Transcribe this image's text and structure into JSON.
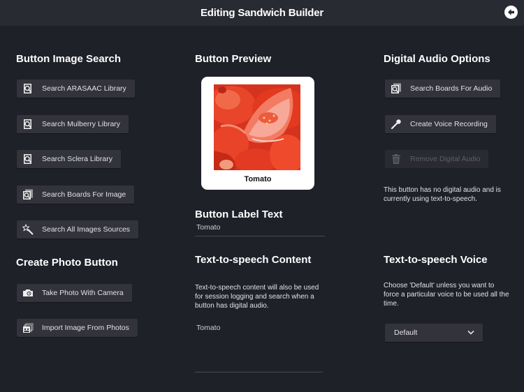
{
  "header": {
    "title": "Editing Sandwich Builder",
    "back_icon": "back-arrow-circle-icon"
  },
  "image_search": {
    "title": "Button Image Search",
    "buttons": [
      {
        "label": "Search ARASAAC Library",
        "icon": "library-search-icon"
      },
      {
        "label": "Search Mulberry Library",
        "icon": "library-search-icon"
      },
      {
        "label": "Search Sclera Library",
        "icon": "library-search-icon"
      },
      {
        "label": "Search Boards For Image",
        "icon": "boards-search-icon"
      },
      {
        "label": "Search All Images Sources",
        "icon": "magic-wand-icon"
      }
    ]
  },
  "photo": {
    "title": "Create Photo Button",
    "buttons": [
      {
        "label": "Take Photo With Camera",
        "icon": "camera-icon"
      },
      {
        "label": "Import Image From Photos",
        "icon": "photos-icon"
      }
    ]
  },
  "preview": {
    "title": "Button Preview",
    "label": "Tomato",
    "image": "tomato-slices-photo"
  },
  "label_text": {
    "title": "Button Label Text",
    "value": "Tomato"
  },
  "tts_content": {
    "title": "Text-to-speech Content",
    "description": "Text-to-speech content will also be used for session logging and search when a button has digital audio.",
    "value": "Tomato"
  },
  "audio": {
    "title": "Digital Audio Options",
    "buttons": [
      {
        "label": "Search Boards For Audio",
        "icon": "boards-search-icon",
        "enabled": true
      },
      {
        "label": "Create Voice Recording",
        "icon": "microphone-icon",
        "enabled": true
      },
      {
        "label": "Remove Digital Audio",
        "icon": "trash-icon",
        "enabled": false
      }
    ],
    "status": "This button has no digital audio and is currently using text-to-speech."
  },
  "tts_voice": {
    "title": "Text-to-speech Voice",
    "description": "Choose 'Default' unless you want to force a particular voice to be used all the time.",
    "selected": "Default"
  },
  "colors": {
    "background": "#1f2129",
    "header": "#292b33",
    "button": "#32333b",
    "text": "#ffffff"
  }
}
